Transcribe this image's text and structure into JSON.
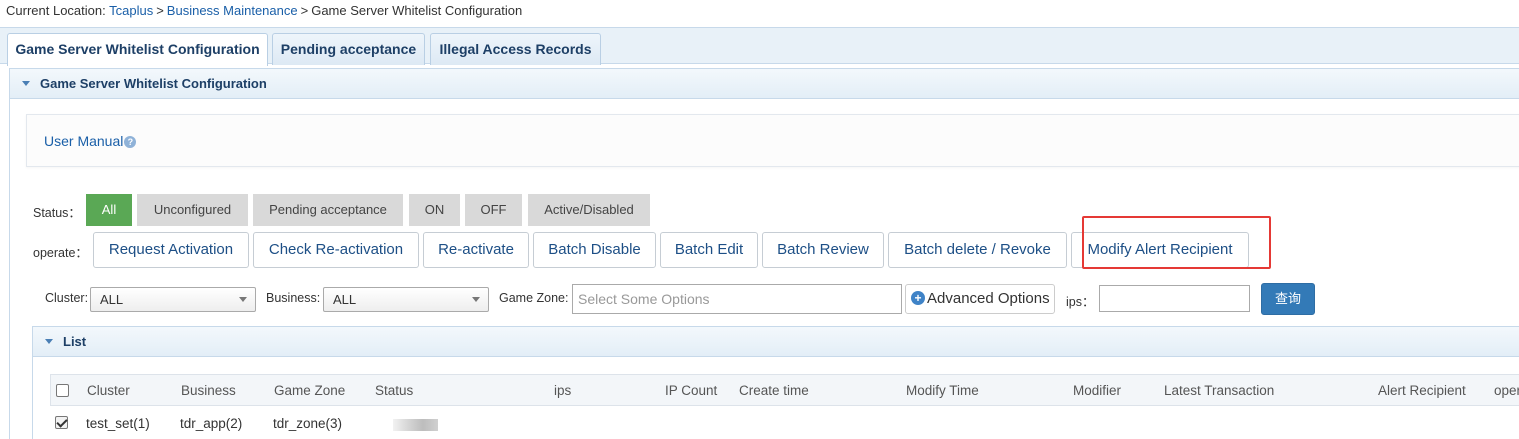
{
  "breadcrumb": {
    "prefix": "Current Location:",
    "items": [
      "Tcaplus",
      "Business Maintenance",
      "Game Server Whitelist Configuration"
    ],
    "separator": ">"
  },
  "tabs": [
    {
      "label": "Game Server Whitelist Configuration",
      "active": true
    },
    {
      "label": "Pending acceptance",
      "active": false
    },
    {
      "label": "Illegal Access Records",
      "active": false
    }
  ],
  "panel": {
    "title": "Game Server Whitelist Configuration",
    "manual_label": "User Manual",
    "help_icon": "question-icon"
  },
  "status": {
    "label": "Status：",
    "options": [
      "All",
      "Unconfigured",
      "Pending acceptance",
      "ON",
      "OFF",
      "Active/Disabled"
    ],
    "selected": "All",
    "active_color": "#5aa855"
  },
  "operate": {
    "label": "operate：",
    "buttons": [
      "Request Activation",
      "Check Re-activation",
      "Re-activate",
      "Batch Disable",
      "Batch Edit",
      "Batch Review",
      "Batch delete / Revoke",
      "Modify Alert Recipient"
    ],
    "highlighted": "Modify Alert Recipient",
    "highlight_color": "#e53935"
  },
  "filters": {
    "cluster_label": "Cluster:",
    "cluster_value": "ALL",
    "business_label": "Business:",
    "business_value": "ALL",
    "zone_label": "Game Zone:",
    "zone_placeholder": "Select Some Options",
    "advanced_label": "Advanced Options",
    "ips_label": "ips：",
    "ips_value": "",
    "query_label": "查询"
  },
  "list": {
    "title": "List",
    "columns": [
      "Cluster",
      "Business",
      "Game Zone",
      "Status",
      "ips",
      "IP Count",
      "Create time",
      "Modify Time",
      "Modifier",
      "Latest Transaction",
      "Alert Recipient",
      "oper"
    ],
    "rows": [
      {
        "checked": true,
        "cluster": "test_set(1)",
        "business": "tdr_app(2)",
        "zone": "tdr_zone(3)"
      }
    ]
  }
}
